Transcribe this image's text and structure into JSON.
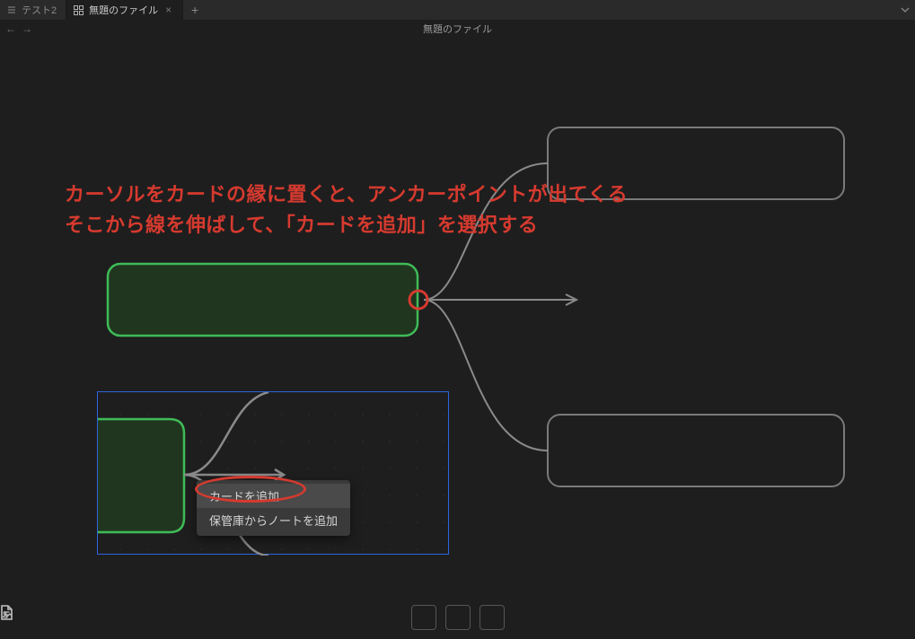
{
  "tabs": {
    "inactive": {
      "label": "テスト2"
    },
    "active": {
      "label": "無題のファイル"
    }
  },
  "title": "無題のファイル",
  "annotation": {
    "line1": "カーソルをカードの縁に置くと、アンカーポイントが出てくる",
    "line2": "そこから線を伸ばして、「カードを追加」を選択する"
  },
  "context_menu": {
    "items": [
      {
        "label": "カードを追加"
      },
      {
        "label": "保管庫からノートを追加"
      }
    ]
  },
  "colors": {
    "card_border_green": "#3fbb58",
    "card_fill_green": "#20361f",
    "card_border_grey": "#7a7a7a",
    "connector_grey": "#8a8a8a",
    "annotation_red": "#d63a2f",
    "selection_blue": "#2f63e0"
  }
}
